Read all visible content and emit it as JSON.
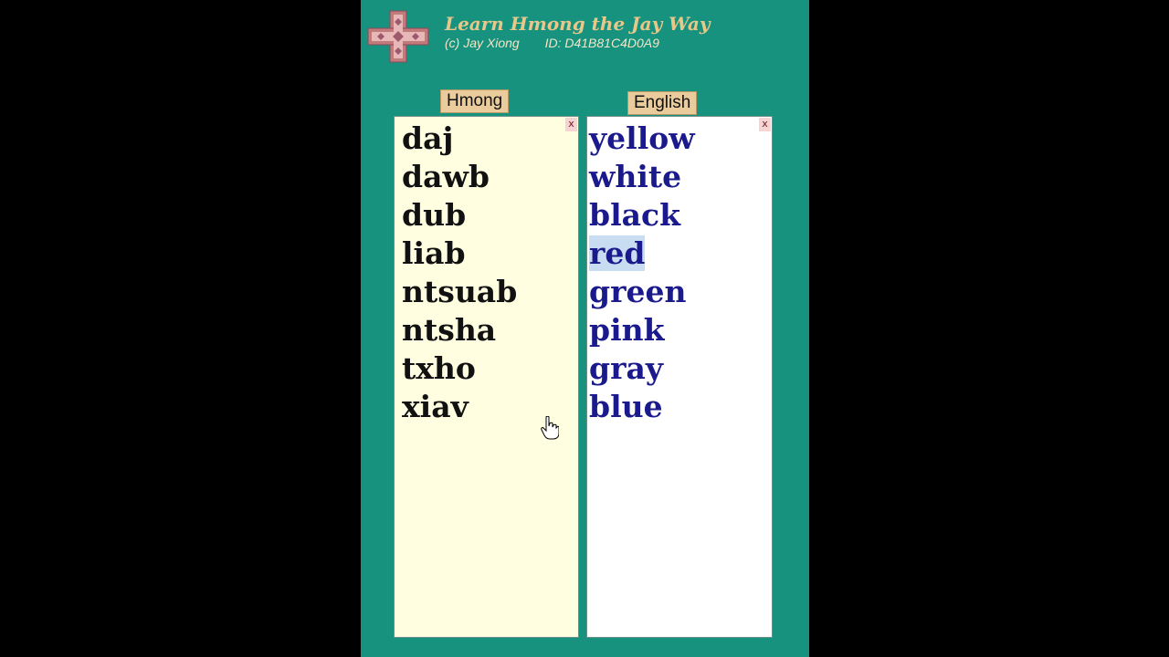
{
  "app": {
    "title": "Learn Hmong the Jay Way",
    "copyright": "(c) Jay Xiong",
    "id_text": "ID: D41B81C4D0A9",
    "logo_icon": "hmong-cross-logo-icon"
  },
  "columns": {
    "hmong": {
      "header": "Hmong",
      "close_label": "x",
      "words": [
        "daj",
        "dawb",
        "dub",
        "liab",
        "ntsuab",
        "ntsha",
        "txho",
        "xiav"
      ]
    },
    "english": {
      "header": "English",
      "close_label": "x",
      "words": [
        "yellow",
        "white",
        "black",
        "red",
        "green",
        "pink",
        "gray",
        "blue"
      ],
      "selected": "red"
    }
  },
  "colors": {
    "background": "#16927f",
    "hmong_panel": "#fffee0",
    "english_text": "#1a1a8c",
    "title": "#e8c88a"
  }
}
